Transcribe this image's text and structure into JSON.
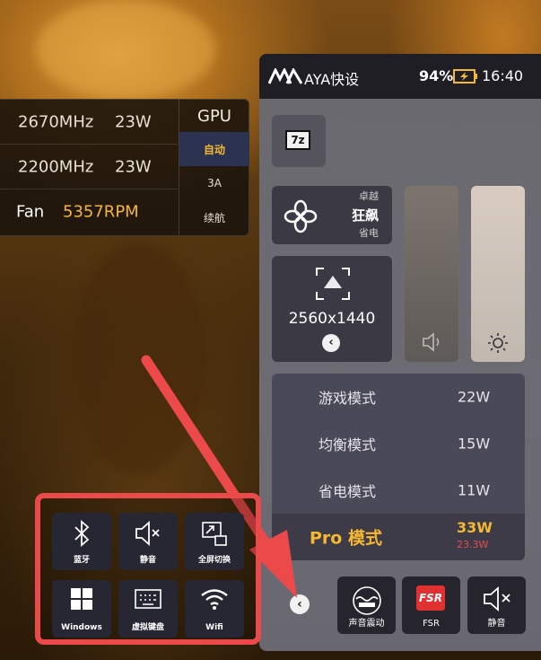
{
  "stats": {
    "row1": {
      "clock": "2670MHz",
      "power": "23W"
    },
    "row2": {
      "clock": "2200MHz",
      "power": "23W"
    },
    "fan": {
      "label": "Fan",
      "rpm": "5357RPM"
    },
    "gpu": {
      "title": "GPU",
      "options": [
        "自动",
        "3A",
        "续航"
      ],
      "selected": "自动"
    }
  },
  "header": {
    "title": "AYA快设",
    "battery": "94%",
    "time": "16:40"
  },
  "app_icon": "7z",
  "performance": {
    "top": "卓越",
    "selected": "狂飙",
    "bottom": "省电"
  },
  "resolution": {
    "value": "2560x1440"
  },
  "sliders": {
    "volume": {
      "icon": "speaker-icon"
    },
    "brightness": {
      "icon": "sun-icon"
    }
  },
  "modes": [
    {
      "name": "游戏模式",
      "watts": "22W"
    },
    {
      "name": "均衡模式",
      "watts": "15W"
    },
    {
      "name": "省电模式",
      "watts": "11W"
    }
  ],
  "pro_mode": {
    "name": "Pro 模式",
    "watts": "33W",
    "sub_watts": "23.3W"
  },
  "quick_actions": [
    {
      "label": "蓝牙",
      "icon": "bluetooth-icon"
    },
    {
      "label": "静音",
      "icon": "mute-icon"
    },
    {
      "label": "全屏切换",
      "icon": "fullscreen-icon"
    },
    {
      "label": "Windows",
      "icon": "windows-icon"
    },
    {
      "label": "虚拟键盘",
      "icon": "keyboard-icon"
    },
    {
      "label": "Wifi",
      "icon": "wifi-icon"
    }
  ],
  "bottom_buttons": [
    {
      "label": "声音震动",
      "icon": "vibration-icon"
    },
    {
      "label": "FSR",
      "icon": "fsr-icon",
      "badge": "FSR"
    },
    {
      "label": "静音",
      "icon": "mute-icon"
    }
  ],
  "colors": {
    "accent_yellow": "#f5b830",
    "highlight_red": "#ec4a4a",
    "pro_red": "#e05050"
  }
}
